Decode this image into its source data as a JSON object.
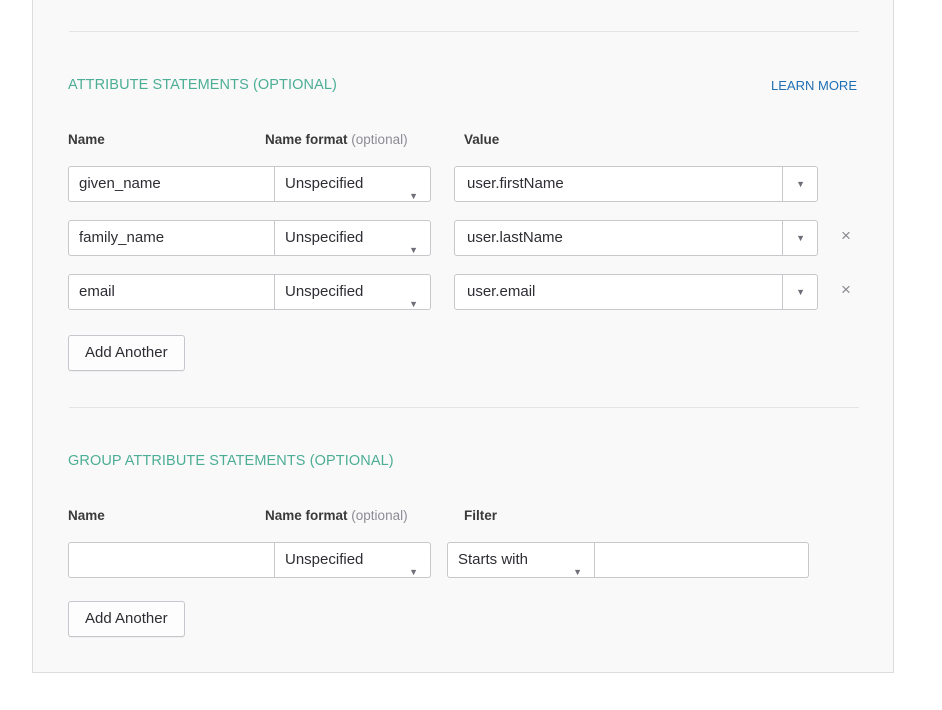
{
  "attribute_statements": {
    "title": "ATTRIBUTE STATEMENTS (OPTIONAL)",
    "learn_more": "LEARN MORE",
    "headers": {
      "name": "Name",
      "name_format": "Name format",
      "name_format_opt": "(optional)",
      "value": "Value"
    },
    "rows": [
      {
        "name": "given_name",
        "format": "Unspecified",
        "value": "user.firstName",
        "removable": false
      },
      {
        "name": "family_name",
        "format": "Unspecified",
        "value": "user.lastName",
        "removable": true
      },
      {
        "name": "email",
        "format": "Unspecified",
        "value": "user.email",
        "removable": true
      }
    ],
    "add_button": "Add Another",
    "remove_symbol": "×"
  },
  "group_attribute_statements": {
    "title": "GROUP ATTRIBUTE STATEMENTS (OPTIONAL)",
    "headers": {
      "name": "Name",
      "name_format": "Name format",
      "name_format_opt": "(optional)",
      "filter": "Filter"
    },
    "row": {
      "name": "",
      "format": "Unspecified",
      "filter_type": "Starts with",
      "filter_value": ""
    },
    "add_button": "Add Another"
  },
  "icons": {
    "dropdown": "caret-down-icon",
    "remove": "close-icon"
  },
  "colors": {
    "section_title": "#4cae95",
    "link": "#1f6fb5",
    "panel_bg": "#f9f9f9"
  }
}
